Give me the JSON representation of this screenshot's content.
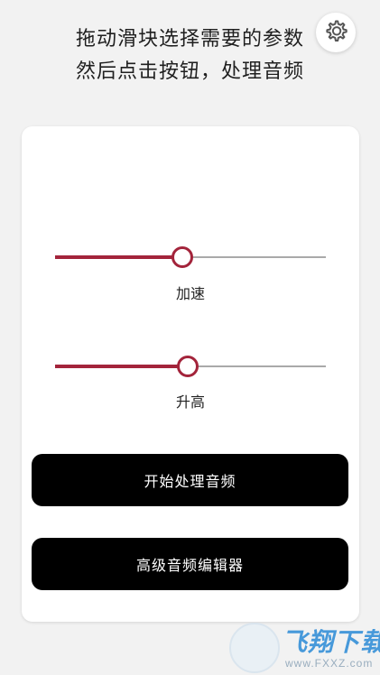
{
  "instructions": {
    "line1": "拖动滑块选择需要的参数",
    "line2": "然后点击按钮，处理音频"
  },
  "settings": {
    "icon": "gear-icon"
  },
  "sliders": [
    {
      "label": "加速",
      "value": 0.47
    },
    {
      "label": "升高",
      "value": 0.49
    }
  ],
  "buttons": {
    "start_label": "开始处理音频",
    "advanced_label": "高级音频编辑器"
  },
  "watermark": {
    "text": "飞翔下载",
    "url": "www.FXXZ.com"
  },
  "colors": {
    "accent": "#a3243b",
    "track": "#a9a9a9",
    "button_bg": "#000000",
    "background": "#f2f2f2",
    "card": "#ffffff"
  }
}
